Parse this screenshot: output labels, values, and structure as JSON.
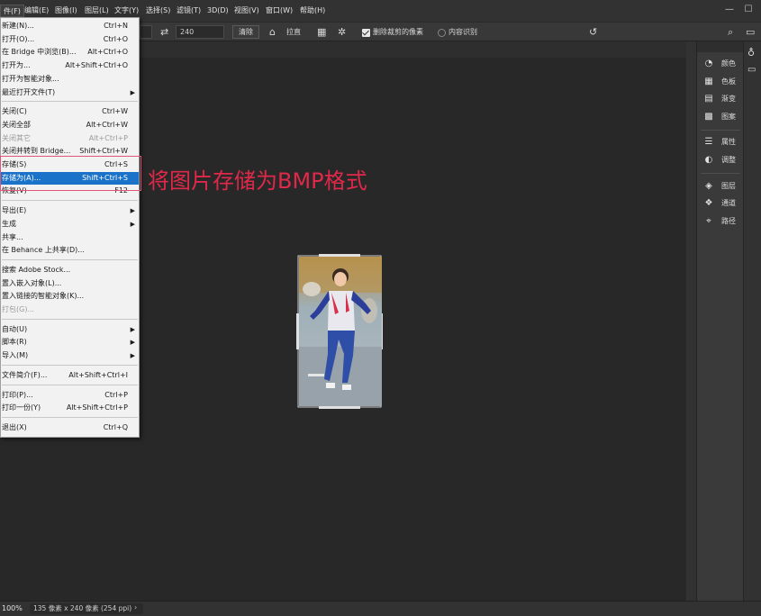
{
  "menubar": {
    "items": [
      "件(F)",
      "编辑(E)",
      "图像(I)",
      "图层(L)",
      "文字(Y)",
      "选择(S)",
      "滤镜(T)",
      "3D(D)",
      "视图(V)",
      "窗口(W)",
      "帮助(H)"
    ],
    "window_controls": [
      "—",
      "☐"
    ]
  },
  "options": {
    "height_value": "240",
    "clear_label": "清除",
    "straighten_label": "拉直",
    "delete_cropped_label": "删除裁剪的像素",
    "content_aware_label": "内容识别"
  },
  "panels": {
    "group1": [
      {
        "icon": "palette-icon",
        "label": "颜色"
      },
      {
        "icon": "swatches-icon",
        "label": "色板"
      },
      {
        "icon": "gradient-icon",
        "label": "渐变"
      },
      {
        "icon": "pattern-icon",
        "label": "图案"
      }
    ],
    "group2": [
      {
        "icon": "properties-icon",
        "label": "属性"
      },
      {
        "icon": "adjustments-icon",
        "label": "调整"
      }
    ],
    "group3": [
      {
        "icon": "layers-icon",
        "label": "图层"
      },
      {
        "icon": "channels-icon",
        "label": "通道"
      },
      {
        "icon": "paths-icon",
        "label": "路径"
      }
    ]
  },
  "file_menu": {
    "items": [
      {
        "label": "新建(N)...",
        "shortcut": "Ctrl+N"
      },
      {
        "label": "打开(O)...",
        "shortcut": "Ctrl+O"
      },
      {
        "label": "在 Bridge 中浏览(B)...",
        "shortcut": "Alt+Ctrl+O"
      },
      {
        "label": "打开为...",
        "shortcut": "Alt+Shift+Ctrl+O"
      },
      {
        "label": "打开为智能对象...",
        "shortcut": ""
      },
      {
        "label": "最近打开文件(T)",
        "shortcut": "",
        "submenu": true
      },
      {
        "sep": true
      },
      {
        "label": "关闭(C)",
        "shortcut": "Ctrl+W"
      },
      {
        "label": "关闭全部",
        "shortcut": "Alt+Ctrl+W"
      },
      {
        "label": "关闭其它",
        "shortcut": "Alt+Ctrl+P",
        "disabled": true
      },
      {
        "label": "关闭并转到 Bridge...",
        "shortcut": "Shift+Ctrl+W"
      },
      {
        "label": "存储(S)",
        "shortcut": "Ctrl+S"
      },
      {
        "label": "存储为(A)...",
        "shortcut": "Shift+Ctrl+S",
        "highlighted": true
      },
      {
        "label": "恢复(V)",
        "shortcut": "F12"
      },
      {
        "sep": true
      },
      {
        "label": "导出(E)",
        "shortcut": "",
        "submenu": true
      },
      {
        "label": "生成",
        "shortcut": "",
        "submenu": true
      },
      {
        "label": "共享...",
        "shortcut": ""
      },
      {
        "label": "在 Behance 上共享(D)...",
        "shortcut": ""
      },
      {
        "sep": true
      },
      {
        "label": "搜索 Adobe Stock...",
        "shortcut": ""
      },
      {
        "label": "置入嵌入对象(L)...",
        "shortcut": ""
      },
      {
        "label": "置入链接的智能对象(K)...",
        "shortcut": ""
      },
      {
        "label": "打包(G)...",
        "shortcut": "",
        "disabled": true
      },
      {
        "sep": true
      },
      {
        "label": "自动(U)",
        "shortcut": "",
        "submenu": true
      },
      {
        "label": "脚本(R)",
        "shortcut": "",
        "submenu": true
      },
      {
        "label": "导入(M)",
        "shortcut": "",
        "submenu": true
      },
      {
        "sep": true
      },
      {
        "label": "文件简介(F)...",
        "shortcut": "Alt+Shift+Ctrl+I"
      },
      {
        "sep": true
      },
      {
        "label": "打印(P)...",
        "shortcut": "Ctrl+P"
      },
      {
        "label": "打印一份(Y)",
        "shortcut": "Alt+Shift+Ctrl+P"
      },
      {
        "sep": true
      },
      {
        "label": "退出(X)",
        "shortcut": "Ctrl+Q"
      }
    ]
  },
  "annotation": {
    "text": "将图片存储为BMP格式",
    "color": "#e0284a"
  },
  "status": {
    "zoom": "100%",
    "doc_info": "135 像素 x 240 像素 (254 ppi)",
    "arrow": "›"
  }
}
